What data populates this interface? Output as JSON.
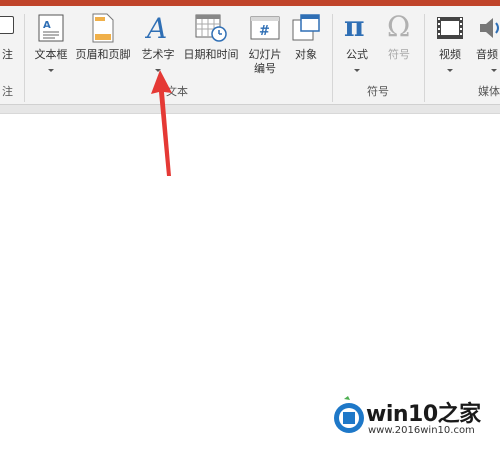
{
  "ribbon": {
    "left_partial": {
      "top_label": "注",
      "bottom_label": "注"
    },
    "text_group": {
      "label": "文本",
      "buttons": [
        {
          "label": "文本框",
          "icon": "textbox-icon",
          "has_dropdown": true
        },
        {
          "label": "页眉和页脚",
          "icon": "header-footer-icon",
          "has_dropdown": false
        },
        {
          "label": "艺术字",
          "icon": "wordart-icon",
          "has_dropdown": true
        },
        {
          "label": "日期和时间",
          "icon": "calendar-clock-icon",
          "has_dropdown": false
        },
        {
          "label_line1": "幻灯片",
          "label_line2": "编号",
          "icon": "slide-number-icon",
          "has_dropdown": false
        },
        {
          "label": "对象",
          "icon": "object-icon",
          "has_dropdown": false
        }
      ]
    },
    "symbols_group": {
      "label": "符号",
      "buttons": [
        {
          "label": "公式",
          "icon": "pi-icon",
          "has_dropdown": true
        },
        {
          "label": "符号",
          "icon": "omega-icon",
          "has_dropdown": false
        }
      ]
    },
    "media_group": {
      "label": "媒体",
      "buttons": [
        {
          "label": "视频",
          "icon": "video-icon",
          "has_dropdown": true
        },
        {
          "label": "音频",
          "icon": "audio-icon",
          "has_dropdown": true
        }
      ]
    }
  },
  "annotation": {
    "arrow_color": "#e53935"
  },
  "watermark": {
    "title": "win10之家",
    "url": "www.2016win10.com"
  },
  "colors": {
    "title_bar": "#c0442a",
    "ribbon_bg": "#f3f3f3",
    "blue_icon": "#2f6fb5"
  }
}
